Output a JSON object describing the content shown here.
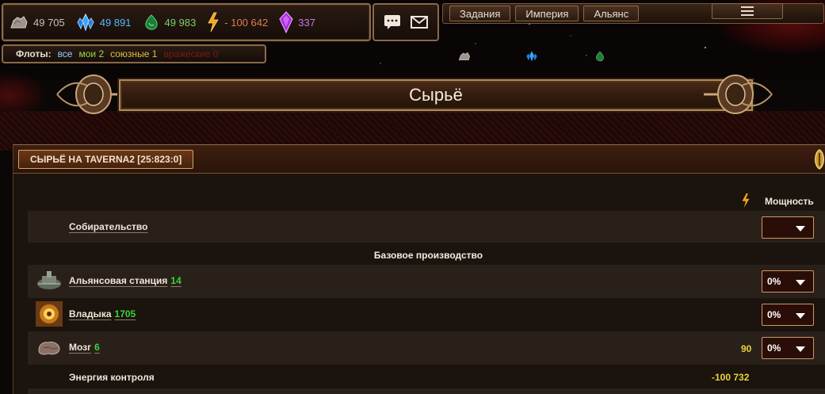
{
  "resources": {
    "metal": {
      "value": "49 705",
      "icon": "metal-ore-icon"
    },
    "crystal": {
      "value": "49 891",
      "icon": "crystal-icon"
    },
    "deuterium": {
      "value": "49 983",
      "icon": "deuterium-icon"
    },
    "energy": {
      "value": "- 100 642",
      "icon": "energy-bolt-icon"
    },
    "dark_matter": {
      "value": "337",
      "icon": "dark-matter-icon"
    }
  },
  "top_menu": [
    "Задания",
    "Империя",
    "Альянс"
  ],
  "fleets": {
    "label": "Флоты:",
    "all": "все",
    "mine": "мои 2",
    "allied": "союзные 1",
    "hostile": "вражеские 0"
  },
  "banner_title": "Сырьё",
  "panel": {
    "header": "СЫРЬЁ НА TAVERNA2 [25:823:0]",
    "power_header": "Мощность"
  },
  "rows": {
    "gathering": {
      "name": "Собирательство",
      "select": ""
    },
    "base_production_title": "Базовое производство",
    "alliance_station": {
      "name": "Альянсовая станция",
      "level": "14",
      "select": "0%"
    },
    "vladyka": {
      "name": "Владыка",
      "level": "1705",
      "select": "0%"
    },
    "brain": {
      "name": "Мозг",
      "level": "6",
      "energy": "90",
      "select": "0%"
    },
    "control_energy": {
      "name": "Энергия контроля",
      "energy": "-100 732"
    }
  },
  "colors": {
    "accent_border": "#8a6a48",
    "level_green": "#39d439",
    "energy_yellow": "#e8d43a",
    "crystal_blue": "#56b8ff",
    "deut_green": "#7ecf6c",
    "energy_orange": "#e07a4f",
    "dm_purple": "#c77ae8"
  }
}
